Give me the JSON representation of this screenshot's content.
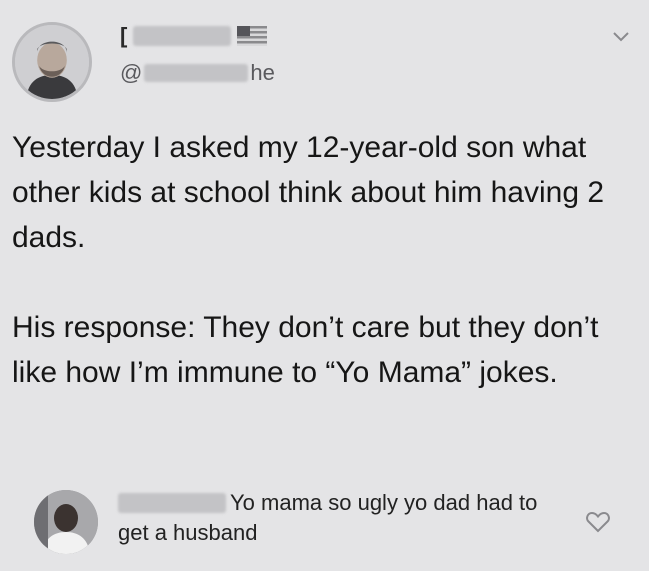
{
  "author": {
    "name_visible_char": "[",
    "handle_prefix": "@",
    "handle_suffix": "he",
    "flag_icon": "us-flag-icon"
  },
  "tweet": {
    "paragraphs": [
      "Yesterday I asked my 12-year-old son what other kids at school think about him having 2 dads.",
      "His response: They don’t care but they don’t like how I’m immune to “Yo Mama” jokes."
    ]
  },
  "reply": {
    "text": "Yo mama so ugly yo dad had to get a husband",
    "like_icon": "heart-outline-icon"
  },
  "colors": {
    "background": "#e4e4e6",
    "text": "#161616",
    "muted": "#5a5a5e"
  }
}
